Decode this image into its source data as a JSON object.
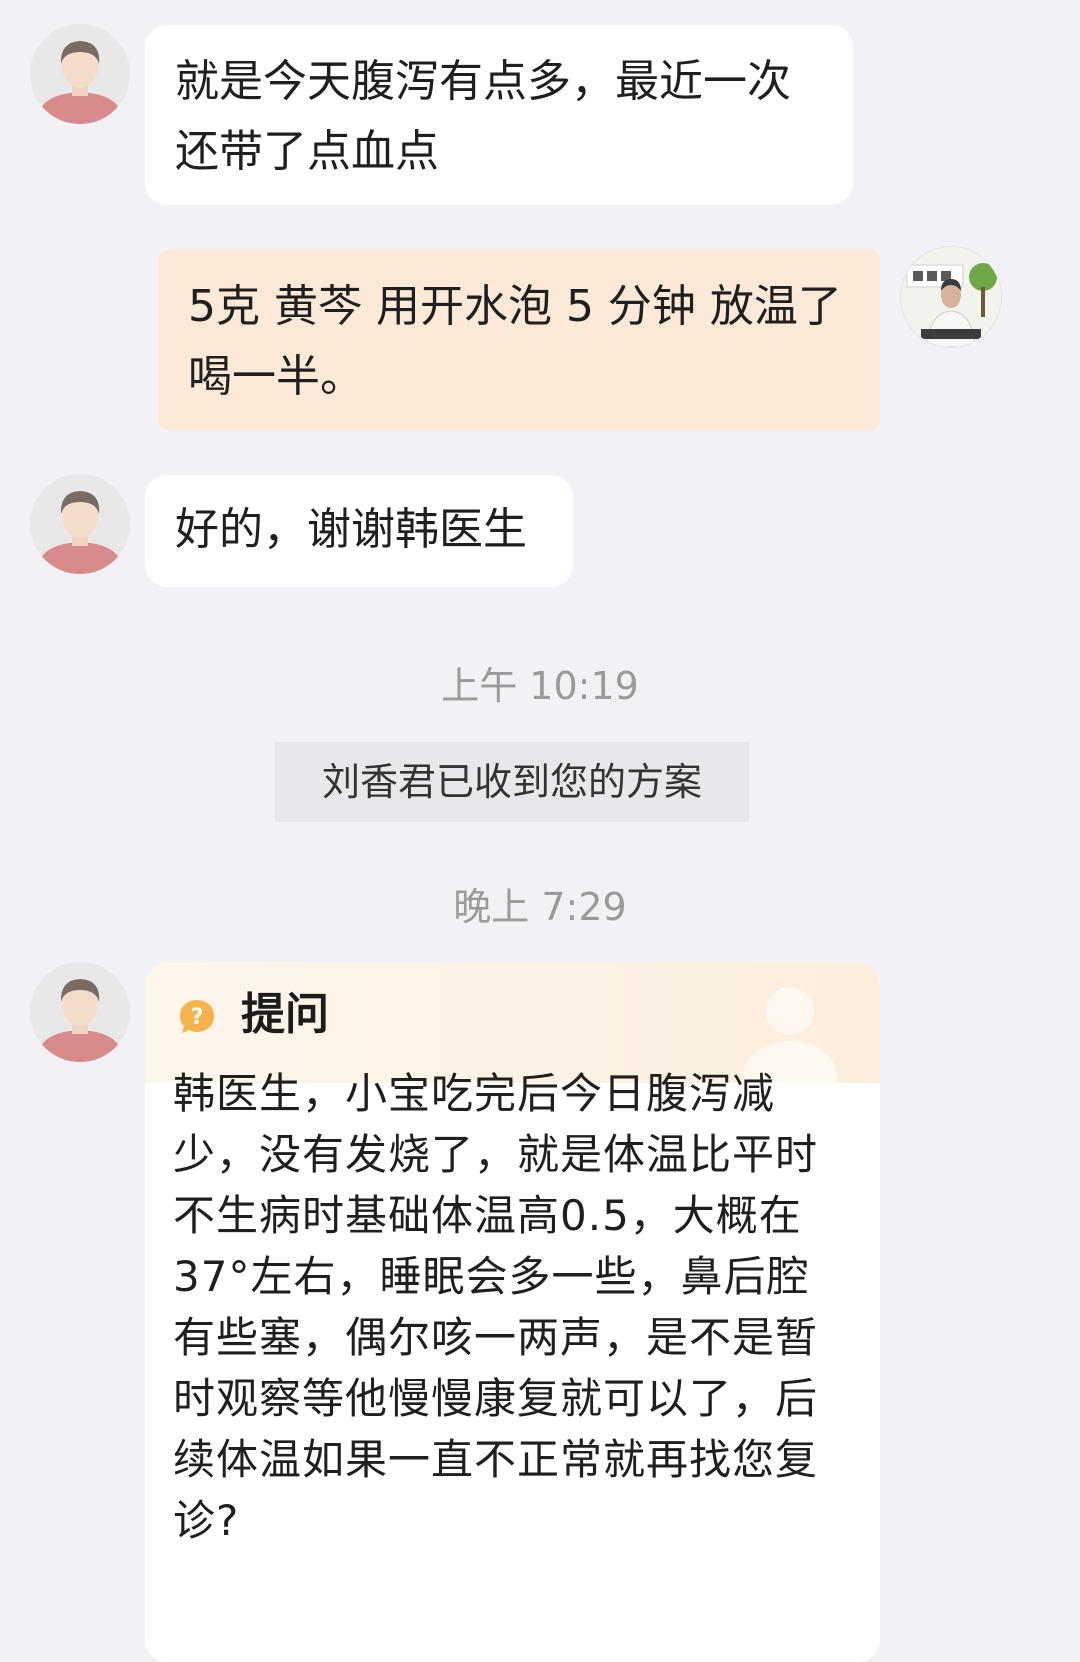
{
  "messages": {
    "m1": "就是今天腹泻有点多，最近一次还带了点血点",
    "m2": "5克 黄芩 用开水泡 5 分钟 放温了喝一半。",
    "m3": "好的，谢谢韩医生"
  },
  "times": {
    "t1": "上午 10:19",
    "t2": "晚上 7:29"
  },
  "system": {
    "received": "刘香君已收到您的方案"
  },
  "question_card": {
    "title": "提问",
    "icon": "question-bubble-icon",
    "body": "韩医生，小宝吃完后今日腹泻减少，没有发烧了，就是体温比平时不生病时基础体温高0.5，大概在37°左右，睡眠会多一些，鼻后腔有些塞，偶尔咳一两声，是不是暂时观察等他慢慢康复就可以了，后续体温如果一直不正常就再找您复诊?"
  },
  "colors": {
    "page_bg": "#f2f2f6",
    "doctor_bubble": "#fde9d8",
    "patient_bubble": "#ffffff",
    "question_icon": "#f7b24c"
  }
}
